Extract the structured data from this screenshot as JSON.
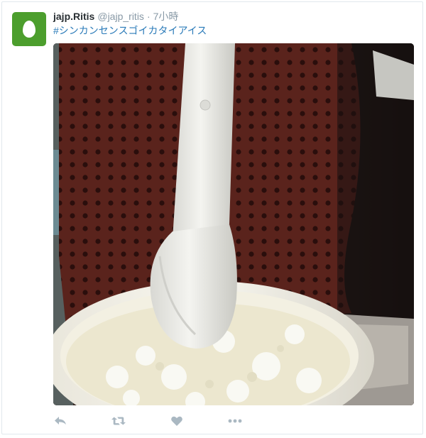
{
  "tweet": {
    "display_name": "jajp.Ritis",
    "handle": "@jajp_ritis",
    "separator": "·",
    "timestamp": "7小時",
    "hashtag": "#シンカンセンスゴイカタイアイス"
  },
  "avatar": {
    "icon": "egg-icon",
    "color": "#4c9e2d"
  },
  "media": {
    "description_icon": "photo"
  },
  "actions": [
    {
      "name": "reply",
      "icon": "reply-icon"
    },
    {
      "name": "retweet",
      "icon": "retweet-icon"
    },
    {
      "name": "like",
      "icon": "heart-icon"
    },
    {
      "name": "more",
      "icon": "more-icon"
    }
  ],
  "colors": {
    "icon": "#aab8c2",
    "link": "#2b7bb9",
    "name": "#292f33",
    "meta": "#8899a6"
  }
}
